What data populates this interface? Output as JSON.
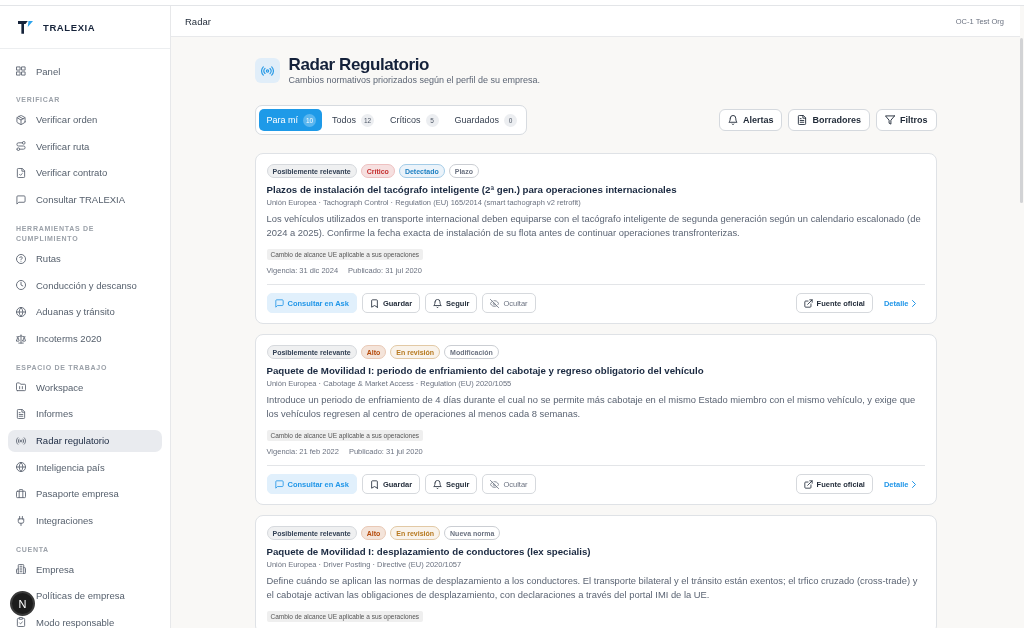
{
  "sidebar": {
    "brand": "TRALEXIA",
    "sections": [
      {
        "items": [
          {
            "label": "Panel",
            "selected": false
          }
        ]
      },
      {
        "title": "VERIFICAR",
        "items": [
          {
            "label": "Verificar orden",
            "selected": false
          },
          {
            "label": "Verificar ruta",
            "selected": false
          },
          {
            "label": "Verificar contrato",
            "selected": false
          },
          {
            "label": "Consultar TRALEXIA",
            "selected": false
          }
        ]
      },
      {
        "title": "HERRAMIENTAS DE CUMPLIMIENTO",
        "items": [
          {
            "label": "Rutas",
            "selected": false
          },
          {
            "label": "Conducción y descanso",
            "selected": false
          },
          {
            "label": "Aduanas y tránsito",
            "selected": false
          },
          {
            "label": "Incoterms 2020",
            "selected": false
          }
        ]
      },
      {
        "title": "ESPACIO DE TRABAJO",
        "items": [
          {
            "label": "Workspace",
            "selected": false
          },
          {
            "label": "Informes",
            "selected": false
          },
          {
            "label": "Radar regulatorio",
            "selected": true
          },
          {
            "label": "Inteligencia país",
            "selected": false
          },
          {
            "label": "Pasaporte empresa",
            "selected": false
          },
          {
            "label": "Integraciones",
            "selected": false
          }
        ]
      },
      {
        "title": "CUENTA",
        "items": [
          {
            "label": "Empresa",
            "selected": false
          },
          {
            "label": "Políticas de empresa",
            "selected": false
          },
          {
            "label": "Modo responsable",
            "selected": false
          }
        ]
      }
    ]
  },
  "floating_button": {
    "label": "N"
  },
  "header": {
    "breadcrumb": "Radar",
    "organization": "OC-1 Test Org"
  },
  "page": {
    "title": "Radar Regulatorio",
    "subtitle": "Cambios normativos priorizados según el perfil de su empresa."
  },
  "tabs": [
    {
      "label": "Para mí",
      "count": "10",
      "selected": true
    },
    {
      "label": "Todos",
      "count": "12",
      "selected": false
    },
    {
      "label": "Críticos",
      "count": "5",
      "selected": false
    },
    {
      "label": "Guardados",
      "count": "0",
      "selected": false
    }
  ],
  "toolbar": [
    "Alertas",
    "Borradores",
    "Filtros"
  ],
  "cards": [
    {
      "tags": [
        {
          "label": "Posiblemente relevante",
          "kind": "relevance",
          "color": "#334155"
        },
        {
          "label": "Crítico",
          "kind": "severity",
          "color": "#c53030"
        },
        {
          "label": "Detectado",
          "kind": "status",
          "color": "#1c7fc2"
        },
        {
          "label": "Plazo",
          "kind": "type",
          "color": "#6b7280"
        }
      ],
      "title": "Plazos de instalación del tacógrafo inteligente (2ª gen.) para operaciones internacionales",
      "source": "Unión Europea · Tachograph Control · Regulation (EU) 165/2014 (smart tachograph v2 retrofit)",
      "description": "Los vehículos utilizados en transporte internacional deben equiparse con el tacógrafo inteligente de segunda generación según un calendario escalonado (de 2024 a 2025). Confirme la fecha exacta de instalación de su flota antes de continuar operaciones transfronterizas.",
      "scope": "Cambio de alcance UE aplicable a sus operaciones",
      "dates": [
        "Vigencia: 31 dic 2024",
        "Publicado: 31 jul 2020"
      ],
      "actions": [
        {
          "label": "Consultar en Ask",
          "kind": "primary"
        },
        {
          "label": "Guardar",
          "kind": "outline"
        },
        {
          "label": "Seguir",
          "kind": "outline"
        },
        {
          "label": "Ocultar",
          "kind": "muted"
        }
      ],
      "source_link": "Fuente oficial",
      "detail_link": "Detalle"
    },
    {
      "tags": [
        {
          "label": "Posiblemente relevante",
          "kind": "relevance",
          "color": "#334155"
        },
        {
          "label": "Alto",
          "kind": "severity",
          "color": "#b54a0b"
        },
        {
          "label": "En revisión",
          "kind": "status",
          "color": "#b7791f"
        },
        {
          "label": "Modificación",
          "kind": "type",
          "color": "#6b7280"
        }
      ],
      "title": "Paquete de Movilidad I: periodo de enfriamiento del cabotaje y regreso obligatorio del vehículo",
      "source": "Unión Europea · Cabotage & Market Access · Regulation (EU) 2020/1055",
      "description": "Introduce un periodo de enfriamiento de 4 días durante el cual no se permite más cabotaje en el mismo Estado miembro con el mismo vehículo, y exige que los vehículos regresen al centro de operaciones al menos cada 8 semanas.",
      "scope": "Cambio de alcance UE aplicable a sus operaciones",
      "dates": [
        "Vigencia: 21 feb 2022",
        "Publicado: 31 jul 2020"
      ],
      "actions": [
        {
          "label": "Consultar en Ask",
          "kind": "primary"
        },
        {
          "label": "Guardar",
          "kind": "outline"
        },
        {
          "label": "Seguir",
          "kind": "outline"
        },
        {
          "label": "Ocultar",
          "kind": "muted"
        }
      ],
      "source_link": "Fuente oficial",
      "detail_link": "Detalle"
    },
    {
      "tags": [
        {
          "label": "Posiblemente relevante",
          "kind": "relevance",
          "color": "#334155"
        },
        {
          "label": "Alto",
          "kind": "severity",
          "color": "#b54a0b"
        },
        {
          "label": "En revisión",
          "kind": "status",
          "color": "#b7791f"
        },
        {
          "label": "Nueva norma",
          "kind": "type",
          "color": "#6b7280"
        }
      ],
      "title": "Paquete de Movilidad I: desplazamiento de conductores (lex specialis)",
      "source": "Unión Europea · Driver Posting · Directive (EU) 2020/1057",
      "description": "Define cuándo se aplican las normas de desplazamiento a los conductores. El transporte bilateral y el tránsito están exentos; el trfico cruzado (cross-trade) y el cabotaje activan las obligaciones de desplazamiento, con declaraciones a través del portal IMI de la UE.",
      "scope": "Cambio de alcance UE aplicable a sus operaciones"
    }
  ]
}
